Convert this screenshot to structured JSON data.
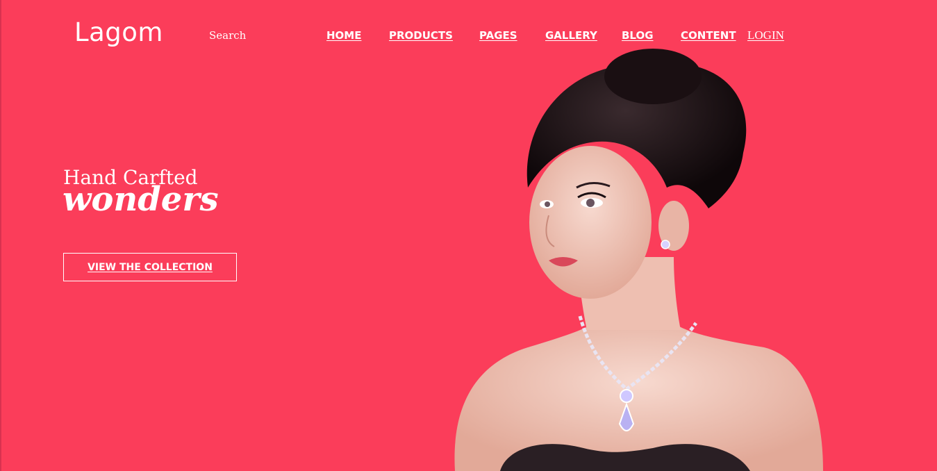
{
  "brand": {
    "logo_text": "Lagom"
  },
  "search": {
    "label": "Search"
  },
  "nav": {
    "home": "HOME",
    "products": "PRODUCTS",
    "pages": "PAGES",
    "gallery": "GALLERY",
    "blog": "BLOG",
    "content": "CONTENT",
    "login": "LOGIN"
  },
  "hero": {
    "line1": "Hand Carfted",
    "line2": "wonders",
    "cta_label": "VIEW THE COLLECTION"
  },
  "colors": {
    "background": "#fb3d5a",
    "text": "#ffffff",
    "hair": "#1a0f12",
    "skin": "#f2c9bd"
  }
}
